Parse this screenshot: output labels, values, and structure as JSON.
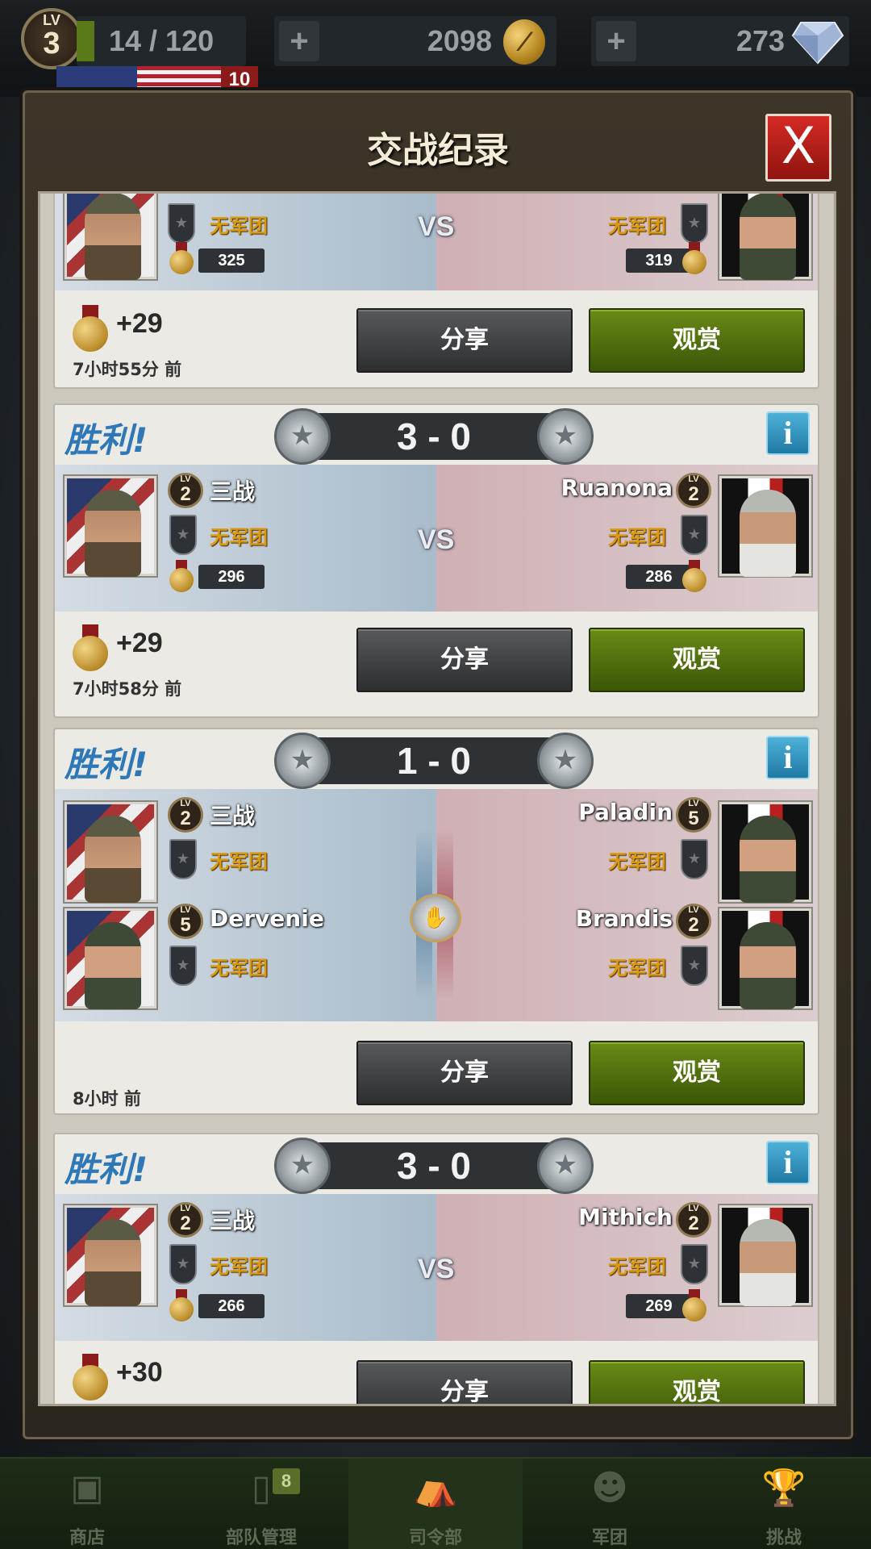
{
  "top": {
    "lv_label": "LV",
    "lv_value": "3",
    "xp": "14 / 120",
    "gold": "2098",
    "gems": "273",
    "flag_count": "10",
    "plus": "+"
  },
  "panel": {
    "title": "交战纪录",
    "close": "X"
  },
  "common": {
    "vs": "VS",
    "share": "分享",
    "watch": "观赏",
    "corps": "无军团",
    "win": "胜利!",
    "lv": "LV",
    "info": "i"
  },
  "records": [
    {
      "left_medal": "325",
      "right_medal": "319",
      "gain": "+29",
      "ago": "7小时55分 前"
    },
    {
      "score": "3 - 0",
      "left_name": "三战",
      "left_lv": "2",
      "left_medal": "296",
      "right_name": "Ruanona",
      "right_lv": "2",
      "right_medal": "286",
      "gain": "+29",
      "ago": "7小时58分 前"
    },
    {
      "score": "1 - 0",
      "left": [
        {
          "name": "三战",
          "lv": "2"
        },
        {
          "name": "Dervenie",
          "lv": "5"
        }
      ],
      "right": [
        {
          "name": "Paladin",
          "lv": "5"
        },
        {
          "name": "Brandis",
          "lv": "2"
        }
      ],
      "ago": "8小时 前"
    },
    {
      "score": "3 - 0",
      "left_name": "三战",
      "left_lv": "2",
      "left_medal": "266",
      "right_name": "Mithich",
      "right_lv": "2",
      "right_medal": "269",
      "gain": "+30"
    }
  ],
  "tabs": [
    {
      "label": "商店",
      "icon": "box-icon"
    },
    {
      "label": "部队管理",
      "icon": "cards-icon",
      "badge": "8"
    },
    {
      "label": "司令部",
      "icon": "hq-icon"
    },
    {
      "label": "军团",
      "icon": "group-icon"
    },
    {
      "label": "挑战",
      "icon": "trophy-icon"
    }
  ]
}
